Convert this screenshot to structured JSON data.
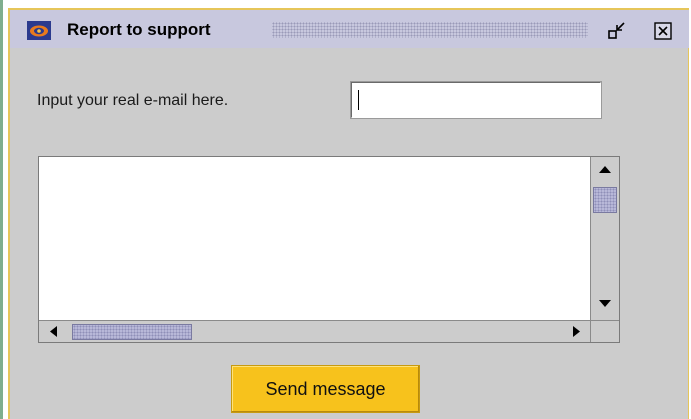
{
  "window": {
    "title": "Report to support",
    "app_icon": "eye-logo-icon",
    "controls": {
      "minimize_icon": "restore-minimize-icon",
      "close_icon": "close-icon"
    }
  },
  "form": {
    "email_label": "Input your real e-mail here.",
    "email_value": "",
    "email_placeholder": "",
    "message_value": "",
    "send_label": "Send message"
  },
  "scrollbars": {
    "vertical": {
      "up_icon": "arrow-up-icon",
      "down_icon": "arrow-down-icon",
      "position": 0
    },
    "horizontal": {
      "left_icon": "arrow-left-icon",
      "right_icon": "arrow-right-icon",
      "position": 0
    }
  },
  "colors": {
    "titlebar": "#c8c8de",
    "window_bg": "#cccccc",
    "border_accent": "#e6c65a",
    "send_button": "#f7c21c",
    "scroll_thumb": "#b8b8d8"
  }
}
